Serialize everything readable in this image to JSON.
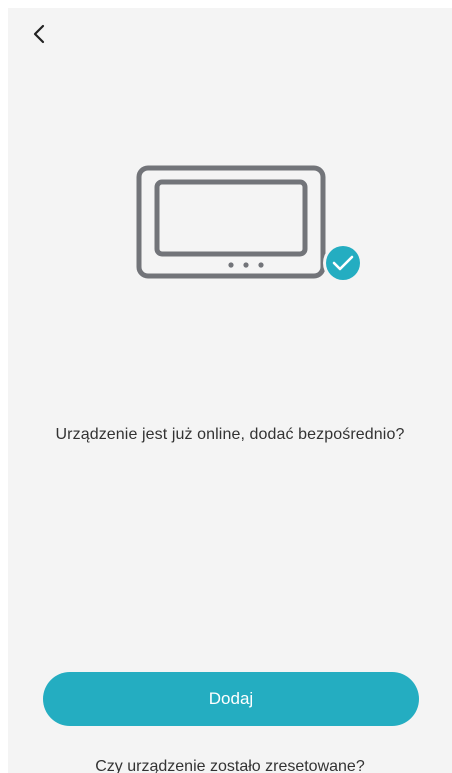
{
  "header": {
    "back_icon": "chevron-left-icon"
  },
  "illustration": {
    "device_icon": "monitor-device-icon",
    "status_icon": "check-circle-icon",
    "accent_color": "#24adc1",
    "outline_color": "#727479"
  },
  "main": {
    "message": "Urządzenie jest już online, dodać bezpośrednio?"
  },
  "actions": {
    "add_label": "Dodaj",
    "reset_link": "Czy urządzenie zostało zresetowane?"
  }
}
